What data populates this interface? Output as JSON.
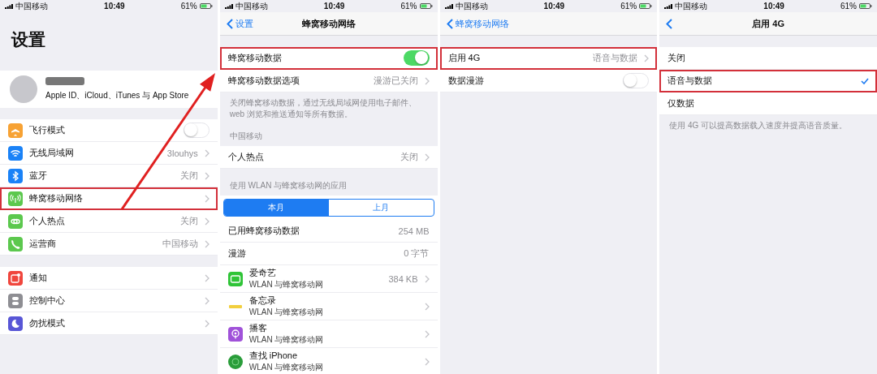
{
  "screens": [
    {
      "status": {
        "carrier": "中国移动",
        "time": "10:49",
        "battery": "61%"
      },
      "large_title": "设置",
      "sections": [
        {
          "items": [
            {
              "kind": "profile",
              "subtitle": "Apple ID、iCloud、iTunes 与 App Store"
            }
          ]
        },
        {
          "items": [
            {
              "kind": "toggle",
              "label": "飞行模式",
              "on": false,
              "color": "#f7a234",
              "highlighted": false
            },
            {
              "kind": "row",
              "label": "无线局域网",
              "value": "3louhys",
              "chevron": true,
              "color": "#1a82f7",
              "highlighted": false
            },
            {
              "kind": "row",
              "label": "蓝牙",
              "value": "关闭",
              "chevron": true,
              "color": "#1a82f7",
              "highlighted": false
            },
            {
              "kind": "row",
              "label": "蜂窝移动网络",
              "chevron": true,
              "color": "#5cc84e",
              "highlighted": true
            },
            {
              "kind": "row",
              "label": "个人热点",
              "value": "关闭",
              "chevron": true,
              "color": "#5cc84e",
              "highlighted": false
            },
            {
              "kind": "row",
              "label": "运营商",
              "value": "中国移动",
              "chevron": true,
              "color": "#5cc84e",
              "highlighted": false
            }
          ]
        },
        {
          "items": [
            {
              "kind": "row",
              "label": "通知",
              "chevron": true,
              "color": "#f0463d",
              "highlighted": false
            },
            {
              "kind": "row",
              "label": "控制中心",
              "chevron": true,
              "color": "#8e8e93",
              "highlighted": false
            },
            {
              "kind": "row",
              "label": "勿扰模式",
              "chevron": true,
              "color": "#5856d6",
              "highlighted": false
            }
          ]
        }
      ]
    },
    {
      "status": {
        "carrier": "中国移动",
        "time": "10:49",
        "battery": "61%"
      },
      "nav": {
        "back": "设置",
        "title": "蜂窝移动网络"
      },
      "sections": [
        {
          "items": [
            {
              "kind": "toggle",
              "label": "蜂窝移动数据",
              "on": true,
              "highlighted": true
            },
            {
              "kind": "row",
              "label": "蜂窝移动数据选项",
              "value": "漫游已关闭",
              "chevron": true,
              "highlighted": false
            }
          ],
          "footer": "关闭蜂窝移动数据，通过无线局域网使用电子邮件、web 浏览和推送通知等所有数据。"
        },
        {
          "header": "中国移动",
          "items": [
            {
              "kind": "row",
              "label": "个人热点",
              "value": "关闭",
              "chevron": true,
              "highlighted": false
            }
          ]
        },
        {
          "header": "使用 WLAN 与蜂窝移动网的应用",
          "items": [
            {
              "kind": "segmented",
              "segments": [
                {
                  "label": "本月",
                  "selected": true
                },
                {
                  "label": "上月",
                  "selected": false
                }
              ]
            },
            {
              "kind": "row",
              "label": "已用蜂窝移动数据",
              "value": "254 MB",
              "chevron": false,
              "highlighted": false
            },
            {
              "kind": "row",
              "label": "漫游",
              "value": "0 字节",
              "chevron": false,
              "highlighted": false
            },
            {
              "kind": "app",
              "label": "爱奇艺",
              "subtitle": "WLAN 与蜂窝移动网",
              "value": "384 KB",
              "chevron": true,
              "color": "#2fc437",
              "highlighted": false
            },
            {
              "kind": "app",
              "label": "备忘录",
              "subtitle": "WLAN 与蜂窝移动网",
              "chevron": true,
              "color": "#f2cf3e",
              "highlighted": false
            },
            {
              "kind": "app",
              "label": "播客",
              "subtitle": "WLAN 与蜂窝移动网",
              "chevron": true,
              "color": "#a052d9",
              "highlighted": false
            },
            {
              "kind": "app",
              "label": "查找 iPhone",
              "subtitle": "WLAN 与蜂窝移动网",
              "chevron": true,
              "color": "#2a9d3a",
              "highlighted": false
            }
          ]
        }
      ]
    },
    {
      "status": {
        "carrier": "中国移动",
        "time": "10:49",
        "battery": "61%"
      },
      "nav": {
        "back": "蜂窝移动网络"
      },
      "sections": [
        {
          "items": [
            {
              "kind": "row",
              "label": "启用 4G",
              "value": "语音与数据",
              "chevron": true,
              "highlighted": true
            },
            {
              "kind": "toggle",
              "label": "数据漫游",
              "on": false,
              "highlighted": false
            }
          ]
        }
      ]
    },
    {
      "status": {
        "carrier": "中国移动",
        "time": "10:49",
        "battery": "61%"
      },
      "nav": {
        "title": "启用 4G"
      },
      "sections": [
        {
          "items": [
            {
              "kind": "option",
              "label": "关闭",
              "selected": false,
              "highlighted": false
            },
            {
              "kind": "option",
              "label": "语音与数据",
              "selected": true,
              "highlighted": true
            },
            {
              "kind": "option",
              "label": "仅数据",
              "selected": false,
              "highlighted": false
            }
          ],
          "footer": "使用 4G 可以提高数据载入速度并提高语音质量。"
        }
      ]
    }
  ]
}
